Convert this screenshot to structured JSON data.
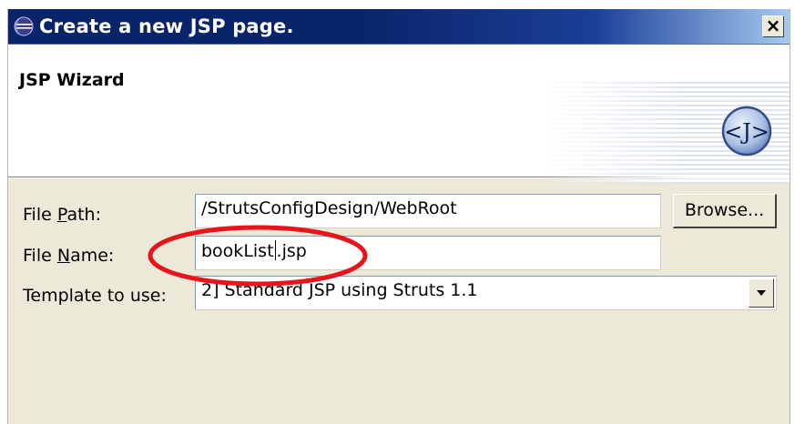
{
  "window": {
    "title": "Create a new JSP page.",
    "close_glyph": "×"
  },
  "header": {
    "wizard_title": "JSP Wizard",
    "icon_text": "<J>"
  },
  "form": {
    "file_path": {
      "label_prefix": "File ",
      "label_mnemonic": "P",
      "label_suffix": "ath:",
      "value": "/StrutsConfigDesign/WebRoot"
    },
    "browse_label": "Browse...",
    "file_name": {
      "label_prefix": "File ",
      "label_mnemonic": "N",
      "label_suffix": "ame:",
      "value_before_caret": "bookList",
      "value_after_caret": ".jsp"
    },
    "template": {
      "label": "Template to use:",
      "selected": "2] Standard JSP using Struts 1.1"
    }
  },
  "annotation": {
    "color": "#e8141b"
  },
  "colors": {
    "titlebar": "#0a246a",
    "dialog_bg": "#ece9d8"
  },
  "icons": [
    "eclipse-icon",
    "close-icon",
    "jsp-wizard-icon",
    "dropdown-arrow-icon"
  ]
}
